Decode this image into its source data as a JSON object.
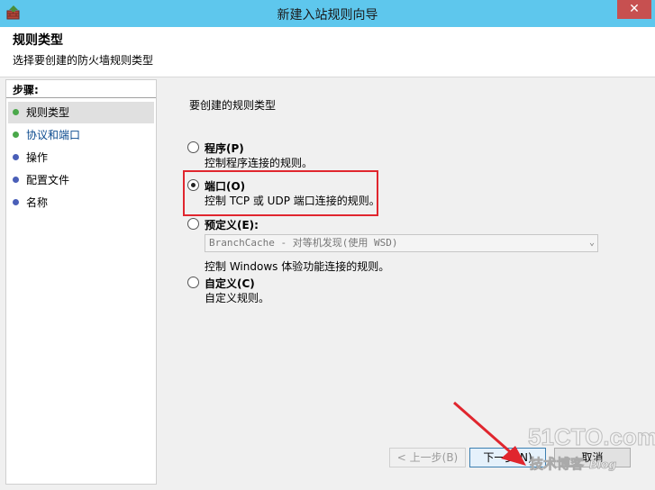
{
  "window": {
    "title": "新建入站规则向导",
    "close_label": "✕",
    "icon": "firewall-wizard-icon"
  },
  "header": {
    "title": "规则类型",
    "subtitle": "选择要创建的防火墙规则类型"
  },
  "steps": {
    "heading": "步骤:",
    "items": [
      {
        "label": "规则类型",
        "state": "current",
        "dot_color": "#4aa84a"
      },
      {
        "label": "协议和端口",
        "state": "link",
        "dot_color": "#4aa84a"
      },
      {
        "label": "操作",
        "state": "normal",
        "dot_color": "#4a5fb8"
      },
      {
        "label": "配置文件",
        "state": "normal",
        "dot_color": "#4a5fb8"
      },
      {
        "label": "名称",
        "state": "normal",
        "dot_color": "#4a5fb8"
      }
    ]
  },
  "content": {
    "question": "要创建的规则类型",
    "options": [
      {
        "label": "程序(P)",
        "description": "控制程序连接的规则。",
        "checked": false
      },
      {
        "label": "端口(O)",
        "description": "控制 TCP 或 UDP 端口连接的规则。",
        "checked": true
      },
      {
        "label": "预定义(E):",
        "description": "控制 Windows 体验功能连接的规则。",
        "checked": false
      },
      {
        "label": "自定义(C)",
        "description": "自定义规则。",
        "checked": false
      }
    ],
    "predefined_select": {
      "value": "BranchCache - 对等机发现(使用 WSD)",
      "enabled": false
    }
  },
  "buttons": {
    "back": "< 上一步(B)",
    "next": "下一步(N)",
    "cancel": "取消"
  },
  "watermark": {
    "main": "51CTO.com",
    "sub": "技术博客",
    "blog": "Blog"
  },
  "colors": {
    "titlebar": "#5ec7ed",
    "highlight": "#e0262e",
    "close": "#c75050"
  }
}
